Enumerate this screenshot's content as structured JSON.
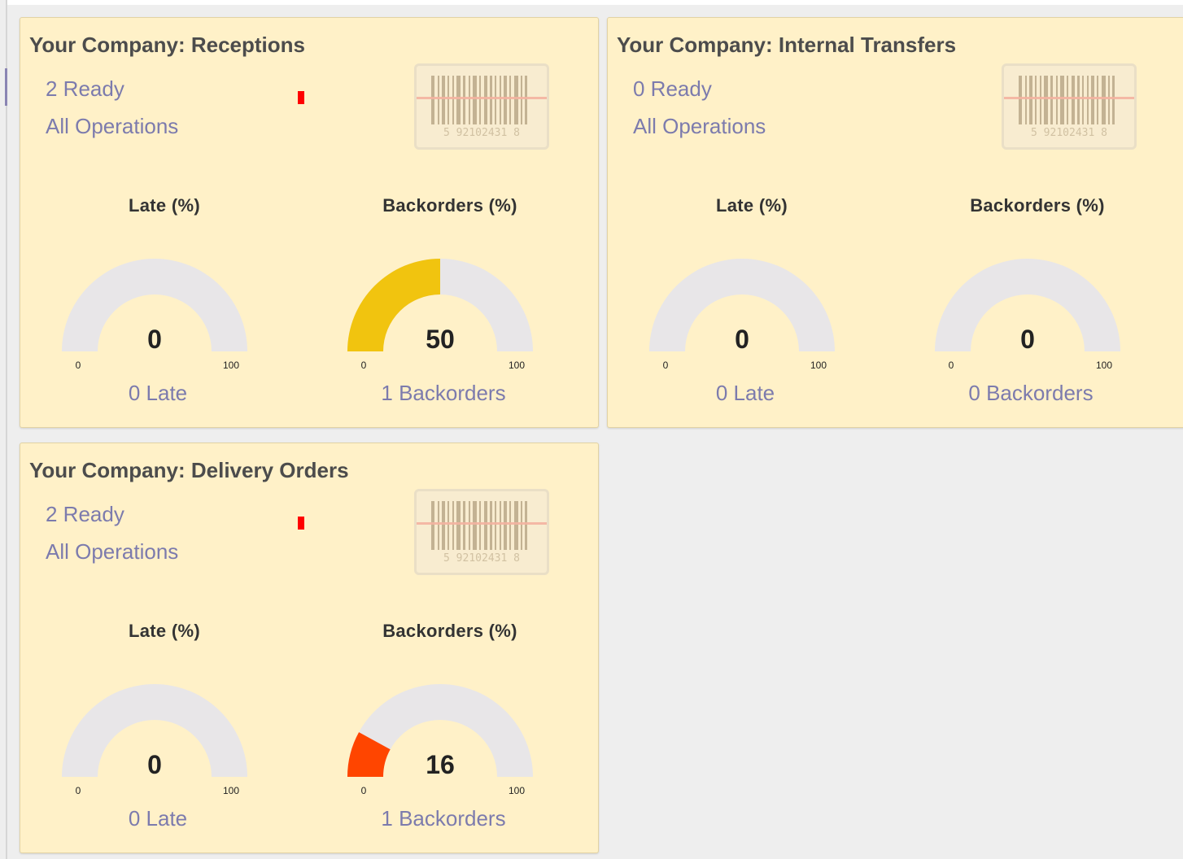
{
  "cards": [
    {
      "title": "Your Company: Receptions",
      "ready_label": "2 Ready",
      "all_ops_label": "All Operations",
      "show_indicator": true,
      "barcode_number": "5  92102431  8",
      "gauges": [
        {
          "title": "Late (%)",
          "value": 0,
          "value_text": "0",
          "min": "0",
          "max": "100",
          "caption": "0 Late",
          "color": "#e8e6e8"
        },
        {
          "title": "Backorders (%)",
          "value": 50,
          "value_text": "50",
          "min": "0",
          "max": "100",
          "caption": "1 Backorders",
          "color": "#f1c40f"
        }
      ]
    },
    {
      "title": "Your Company: Internal Transfers",
      "ready_label": "0 Ready",
      "all_ops_label": "All Operations",
      "show_indicator": false,
      "barcode_number": "5  92102431  8",
      "gauges": [
        {
          "title": "Late (%)",
          "value": 0,
          "value_text": "0",
          "min": "0",
          "max": "100",
          "caption": "0 Late",
          "color": "#e8e6e8"
        },
        {
          "title": "Backorders (%)",
          "value": 0,
          "value_text": "0",
          "min": "0",
          "max": "100",
          "caption": "0 Backorders",
          "color": "#e8e6e8"
        }
      ]
    },
    {
      "title": "Your Company: Delivery Orders",
      "ready_label": "2 Ready",
      "all_ops_label": "All Operations",
      "show_indicator": true,
      "barcode_number": "5  92102431  8",
      "gauges": [
        {
          "title": "Late (%)",
          "value": 0,
          "value_text": "0",
          "min": "0",
          "max": "100",
          "caption": "0 Late",
          "color": "#e8e6e8"
        },
        {
          "title": "Backorders (%)",
          "value": 16,
          "value_text": "16",
          "min": "0",
          "max": "100",
          "caption": "1 Backorders",
          "color": "#ff4500"
        }
      ]
    }
  ],
  "theme": {
    "card_bg": "#fff1c8",
    "link_color": "#7c7bad",
    "gauge_track": "#e8e6e8",
    "indicator": "#ff0000"
  }
}
